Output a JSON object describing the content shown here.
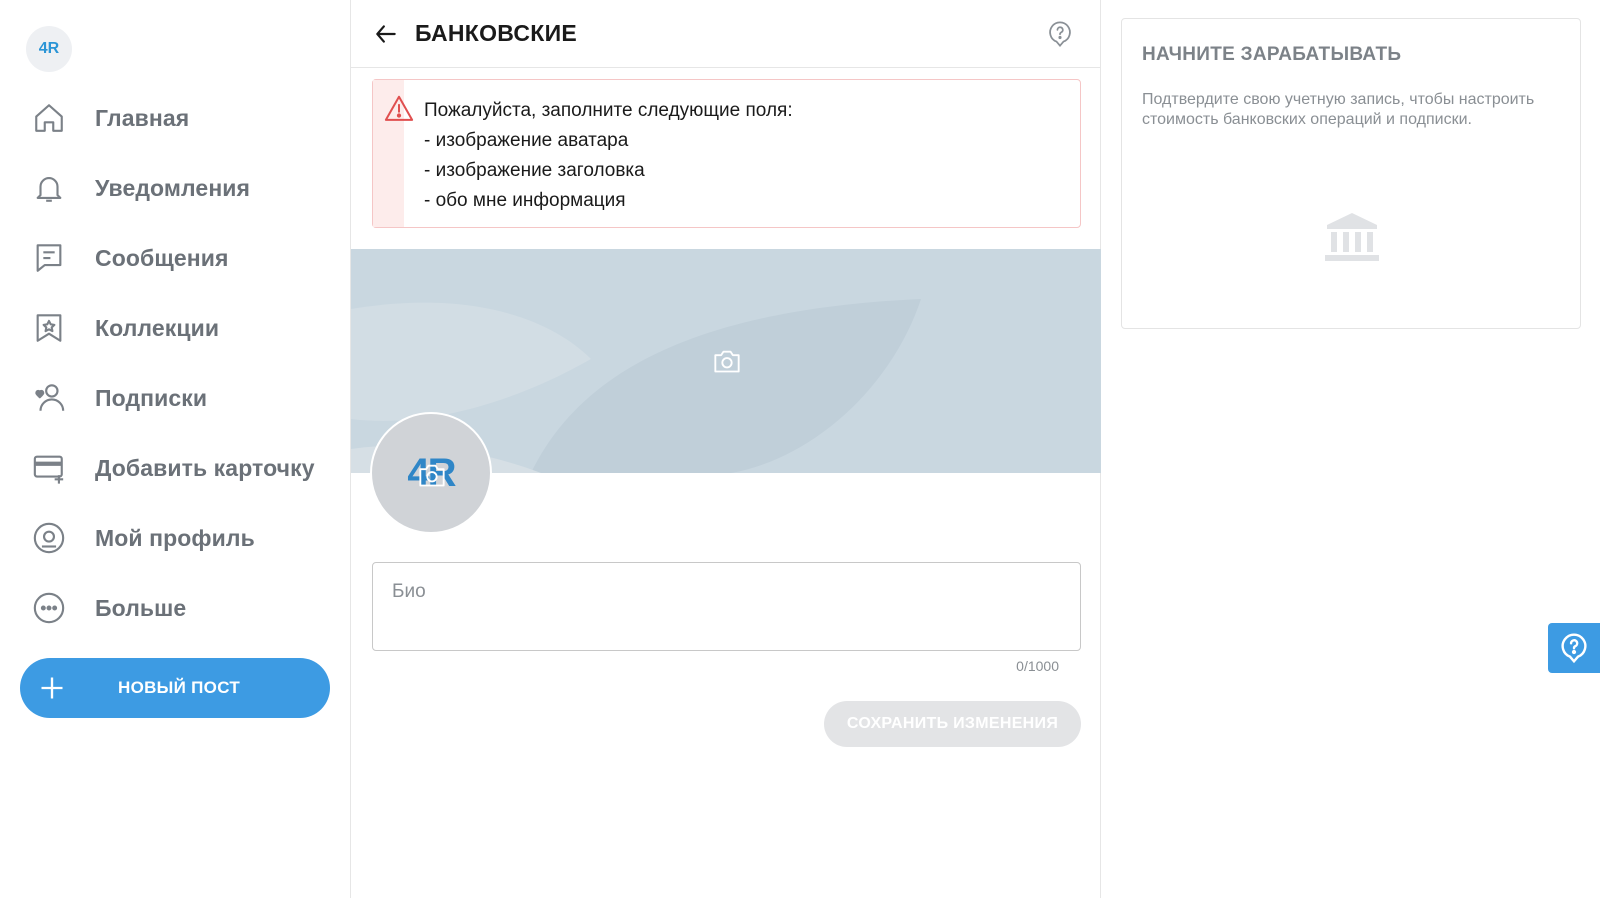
{
  "app": {
    "logo_text": "4R"
  },
  "sidebar": {
    "items": [
      {
        "label": "Главная",
        "icon": "home-icon"
      },
      {
        "label": "Уведомления",
        "icon": "bell-icon"
      },
      {
        "label": "Сообщения",
        "icon": "message-icon"
      },
      {
        "label": "Коллекции",
        "icon": "bookmark-star-icon"
      },
      {
        "label": "Подписки",
        "icon": "subscriptions-icon"
      },
      {
        "label": "Добавить карточку",
        "icon": "add-card-icon"
      },
      {
        "label": "Мой профиль",
        "icon": "profile-icon"
      },
      {
        "label": "Больше",
        "icon": "more-icon"
      }
    ],
    "new_post_label": "НОВЫЙ ПОСТ"
  },
  "header": {
    "title": "БАНКОВСКИЕ"
  },
  "alert": {
    "lines": [
      "Пожалуйста, заполните следующие поля:",
      "- изображение аватара",
      "- изображение заголовка",
      "- обо мне информация"
    ]
  },
  "profile": {
    "avatar_text": "4R"
  },
  "bio": {
    "placeholder": "Био",
    "value": "",
    "counter": "0/1000"
  },
  "actions": {
    "save_label": "СОХРАНИТЬ ИЗМЕНЕНИЯ"
  },
  "earn": {
    "title": "НАЧНИТЕ ЗАРАБАТЫВАТЬ",
    "description": "Подтвердите свою учетную запись, чтобы настроить стоимость банковских операций и подписки."
  },
  "colors": {
    "accent": "#3d9be3",
    "alert_border": "#f5c6c6",
    "alert_icon": "#e04f4f",
    "cover": "#c9d7e0"
  }
}
